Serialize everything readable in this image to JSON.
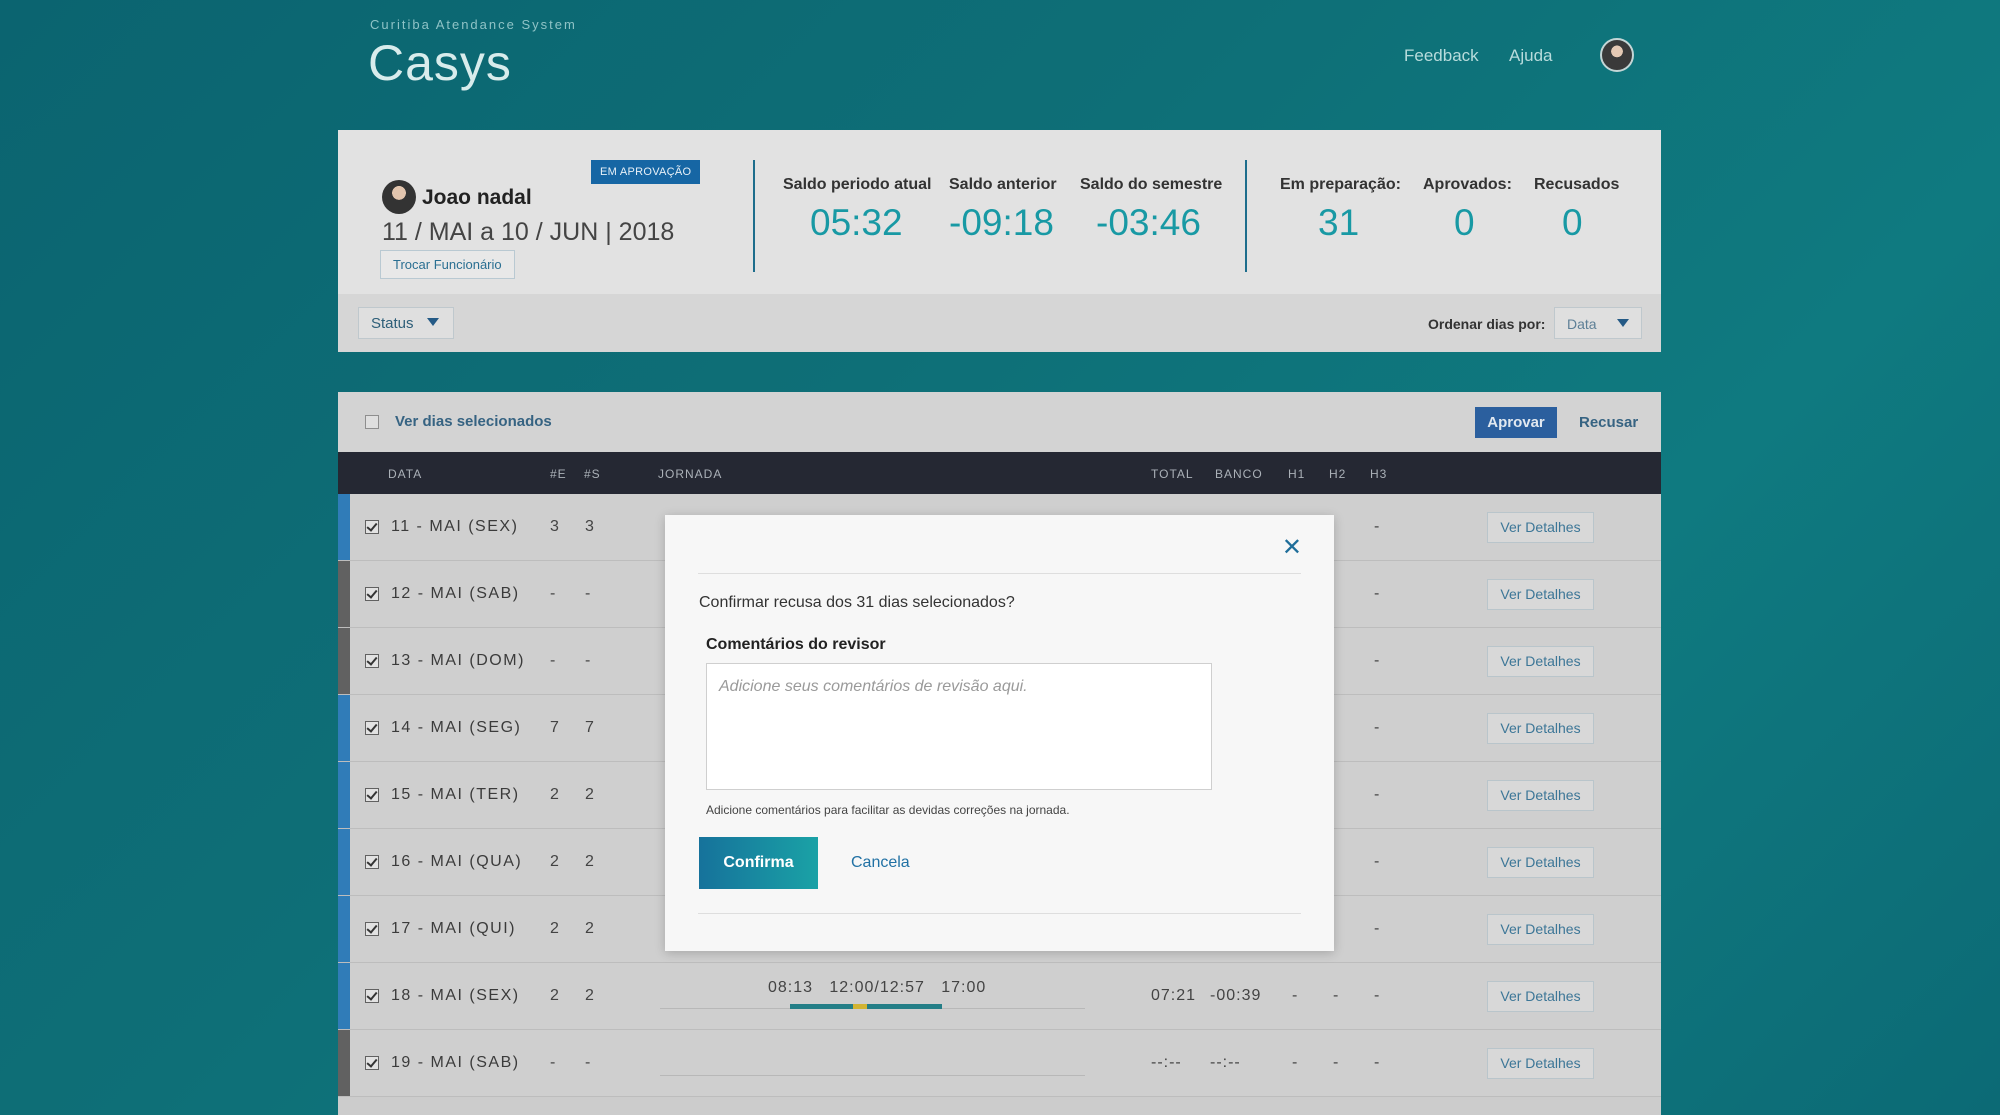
{
  "app": {
    "subtitle": "Curitiba Atendance System",
    "title": "Casys",
    "nav": {
      "feedback": "Feedback",
      "help": "Ajuda"
    }
  },
  "summary": {
    "badge": "EM APROVAÇÃO",
    "employee_name": "Joao nadal",
    "period": "11 / MAI a 10 / JUN | 2018",
    "change_employee": "Trocar Funcionário",
    "stats": [
      {
        "label": "Saldo periodo atual",
        "value": "05:32"
      },
      {
        "label": "Saldo anterior",
        "value": "-09:18"
      },
      {
        "label": "Saldo do semestre",
        "value": "-03:46"
      },
      {
        "label": "Em preparação:",
        "value": "31"
      },
      {
        "label": "Aprovados:",
        "value": "0"
      },
      {
        "label": "Recusados",
        "value": "0"
      }
    ],
    "status_filter": "Status",
    "order_label": "Ordenar dias por:",
    "order_value": "Data"
  },
  "table": {
    "view_selected": "Ver dias selecionados",
    "approve": "Aprovar",
    "reject": "Recusar",
    "headers": {
      "data": "DATA",
      "e": "#E",
      "s": "#S",
      "jornada": "JORNADA",
      "total": "TOTAL",
      "banco": "BANCO",
      "h1": "H1",
      "h2": "H2",
      "h3": "H3"
    },
    "details_label": "Ver Detalhes",
    "rows": [
      {
        "date": "11 - MAI (SEX)",
        "e": "3",
        "s": "3",
        "total": "",
        "banco": "",
        "h1": "",
        "h2": "",
        "h3": "-",
        "times": "",
        "accent": "#1d74b8"
      },
      {
        "date": "12 - MAI (SAB)",
        "e": "-",
        "s": "-",
        "total": "",
        "banco": "",
        "h1": "",
        "h2": "",
        "h3": "-",
        "times": "",
        "accent": "#555555"
      },
      {
        "date": "13 - MAI (DOM)",
        "e": "-",
        "s": "-",
        "total": "",
        "banco": "",
        "h1": "",
        "h2": "",
        "h3": "-",
        "times": "",
        "accent": "#555555"
      },
      {
        "date": "14 - MAI (SEG)",
        "e": "7",
        "s": "7",
        "total": "",
        "banco": "",
        "h1": "",
        "h2": "",
        "h3": "-",
        "times": "",
        "accent": "#1d74b8"
      },
      {
        "date": "15 - MAI (TER)",
        "e": "2",
        "s": "2",
        "total": "",
        "banco": "",
        "h1": "",
        "h2": "",
        "h3": "-",
        "times": "",
        "accent": "#1d74b8"
      },
      {
        "date": "16 - MAI (QUA)",
        "e": "2",
        "s": "2",
        "total": "",
        "banco": "",
        "h1": "",
        "h2": "",
        "h3": "-",
        "times": "",
        "accent": "#1d74b8"
      },
      {
        "date": "17 - MAI (QUI)",
        "e": "2",
        "s": "2",
        "total": "",
        "banco": "",
        "h1": "",
        "h2": "",
        "h3": "-",
        "times": "",
        "accent": "#1d74b8"
      },
      {
        "date": "18 - MAI (SEX)",
        "e": "2",
        "s": "2",
        "total": "07:21",
        "banco": "-00:39",
        "h1": "-",
        "h2": "-",
        "h3": "-",
        "times": "08:13   12:00/12:57   17:00",
        "accent": "#1d74b8"
      },
      {
        "date": "19 - MAI (SAB)",
        "e": "-",
        "s": "-",
        "total": "--:--",
        "banco": "--:--",
        "h1": "-",
        "h2": "-",
        "h3": "-",
        "times": "",
        "accent": "#555555"
      }
    ]
  },
  "modal": {
    "question": "Confirmar recusa dos 31 dias selecionados?",
    "comments_label": "Comentários do revisor",
    "comments_placeholder": "Adicione seus comentários de revisão aqui.",
    "hint": "Adicione comentários para facilitar as devidas correções na jornada.",
    "confirm": "Confirma",
    "cancel": "Cancela"
  }
}
